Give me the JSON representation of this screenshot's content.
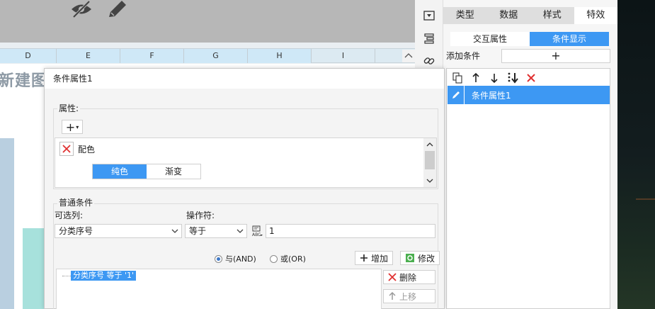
{
  "sheet": {
    "columns": [
      "D",
      "E",
      "F",
      "G",
      "H",
      "I"
    ],
    "title_text": "新建图"
  },
  "panel": {
    "tabs": [
      {
        "label": "类型",
        "active": false
      },
      {
        "label": "数据",
        "active": false
      },
      {
        "label": "样式",
        "active": false
      },
      {
        "label": "特效",
        "active": true
      }
    ],
    "subtabs": [
      {
        "label": "交互属性",
        "active": false
      },
      {
        "label": "条件显示",
        "active": true
      }
    ],
    "add_condition_label": "添加条件",
    "add_condition_button": "+",
    "condition_items": [
      {
        "label": "条件属性1",
        "selected": true
      }
    ]
  },
  "dialog": {
    "title": "条件属性1",
    "attributes_label": "属性:",
    "attribute_add": "+",
    "attribute_name": "配色",
    "color_tabs": [
      {
        "label": "纯色",
        "active": true
      },
      {
        "label": "渐变",
        "active": false
      }
    ],
    "conditions_label": "普通条件",
    "column_label": "可选列:",
    "operator_label": "操作符:",
    "column_value": "分类序号",
    "operator_value": "等于",
    "value": "1",
    "radio_and": "与(AND)",
    "radio_or": "或(OR)",
    "selected_logic": "and",
    "add_button": "增加",
    "modify_button": "修改",
    "delete_button": "删除",
    "up_button": "上移",
    "condition_expression": "分类序号 等于 '1'"
  },
  "colors": {
    "accent": "#3d98f3",
    "delete_red": "#e03131"
  }
}
